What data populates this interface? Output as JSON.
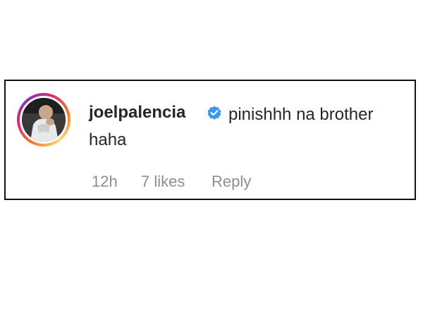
{
  "comment": {
    "username": "joelpalencia",
    "verified": true,
    "text": "pinishhh na brother haha",
    "time": "12h",
    "likes": "7 likes",
    "reply_label": "Reply"
  },
  "colors": {
    "verified_badge": "#3897f0",
    "meta_text": "#8e8e8e",
    "primary_text": "#262626"
  },
  "icons": {
    "verified": "verified-badge-icon",
    "avatar": "avatar"
  }
}
